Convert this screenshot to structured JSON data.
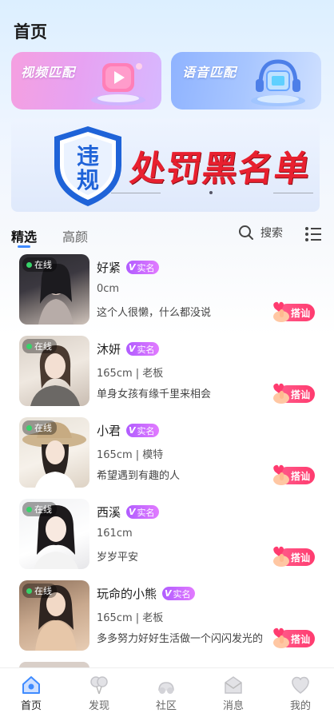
{
  "header": {
    "title": "首页"
  },
  "match": {
    "video_label": "视频匹配",
    "voice_label": "语音匹配"
  },
  "banner": {
    "shield_text_top": "违",
    "shield_text_bottom": "规",
    "text": "处罚黑名单"
  },
  "tabs": {
    "selected": "精选",
    "other": "高颜",
    "search_label": "搜索"
  },
  "badge": {
    "online": "在线",
    "verified": "实名"
  },
  "greet_label": "搭讪",
  "users": [
    {
      "name": "好紧",
      "info": "0cm",
      "bio": "这个人很懒，什么都没说",
      "verified": true
    },
    {
      "name": "沐妍",
      "info": "165cm | 老板",
      "bio": "单身女孩有缘千里来相会",
      "verified": true
    },
    {
      "name": "小君",
      "info": "165cm | 模特",
      "bio": "希望遇到有趣的人",
      "verified": true
    },
    {
      "name": "西溪",
      "info": "161cm",
      "bio": "岁岁平安",
      "verified": true
    },
    {
      "name": "玩命的小熊",
      "info": "165cm | 老板",
      "bio": "多多努力好好生活做一个闪闪发光的",
      "verified": true
    }
  ],
  "tabbar": {
    "items": [
      {
        "label": "首页",
        "icon": "home-icon",
        "active": true
      },
      {
        "label": "发现",
        "icon": "balloon-icon",
        "active": false
      },
      {
        "label": "社区",
        "icon": "community-icon",
        "active": false
      },
      {
        "label": "消息",
        "icon": "mail-icon",
        "active": false
      },
      {
        "label": "我的",
        "icon": "heart-icon",
        "active": false
      }
    ]
  },
  "colors": {
    "accent": "#3f8bff",
    "verified": "#c06cff",
    "greet": "#ff4a7a",
    "banner_red": "#e8202f",
    "online": "#37d36a"
  }
}
